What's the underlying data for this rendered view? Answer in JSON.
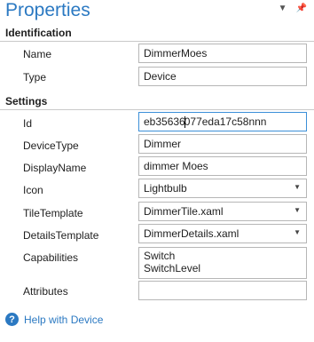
{
  "panel": {
    "title": "Properties"
  },
  "header_icons": [
    {
      "name": "dropdown-arrow-icon",
      "glyph": "▼"
    },
    {
      "name": "pin-icon",
      "glyph": "📌"
    }
  ],
  "sections": {
    "identification": "Identification",
    "settings": "Settings"
  },
  "identification": {
    "name_label": "Name",
    "name_value": "DimmerMoes",
    "type_label": "Type",
    "type_value": "Device"
  },
  "settings": {
    "id_label": "Id",
    "id_value_before_caret": "eb35636",
    "id_value_after_caret": "077eda17c58nnn",
    "devicetype_label": "DeviceType",
    "devicetype_value": "Dimmer",
    "displayname_label": "DisplayName",
    "displayname_value": "dimmer Moes",
    "icon_label": "Icon",
    "icon_value": "Lightbulb",
    "tiletemplate_label": "TileTemplate",
    "tiletemplate_value": "DimmerTile.xaml",
    "detailstemplate_label": "DetailsTemplate",
    "detailstemplate_value": "DimmerDetails.xaml",
    "capabilities_label": "Capabilities",
    "capabilities_line1": "Switch",
    "capabilities_line2": "SwitchLevel",
    "attributes_label": "Attributes",
    "attributes_value": ""
  },
  "help": {
    "link_text": "Help with Device"
  },
  "colors": {
    "accent": "#2b79c2",
    "focus_border": "#3b8fd8",
    "border": "#b6b6b6"
  }
}
